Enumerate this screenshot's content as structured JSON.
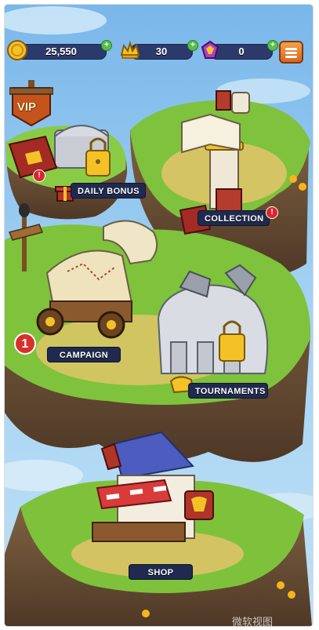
{
  "resources": {
    "coins": "25,550",
    "crowns": "30",
    "gems": "0",
    "plus": "+"
  },
  "badges": {
    "alert": "!",
    "campaign_count": "1"
  },
  "vip_label": "VIP",
  "locations": {
    "daily_bonus": "DAILY BONUS",
    "collection": "COLLECTION",
    "campaign": "CAMPAIGN",
    "tournaments": "TOURNAMENTS",
    "shop": "SHOP"
  },
  "watermark": "微软视图",
  "icons": [
    "coin-icon",
    "crown-icon",
    "gem-icon",
    "menu-icon",
    "lock-icon",
    "gift-icon",
    "book-icon"
  ]
}
